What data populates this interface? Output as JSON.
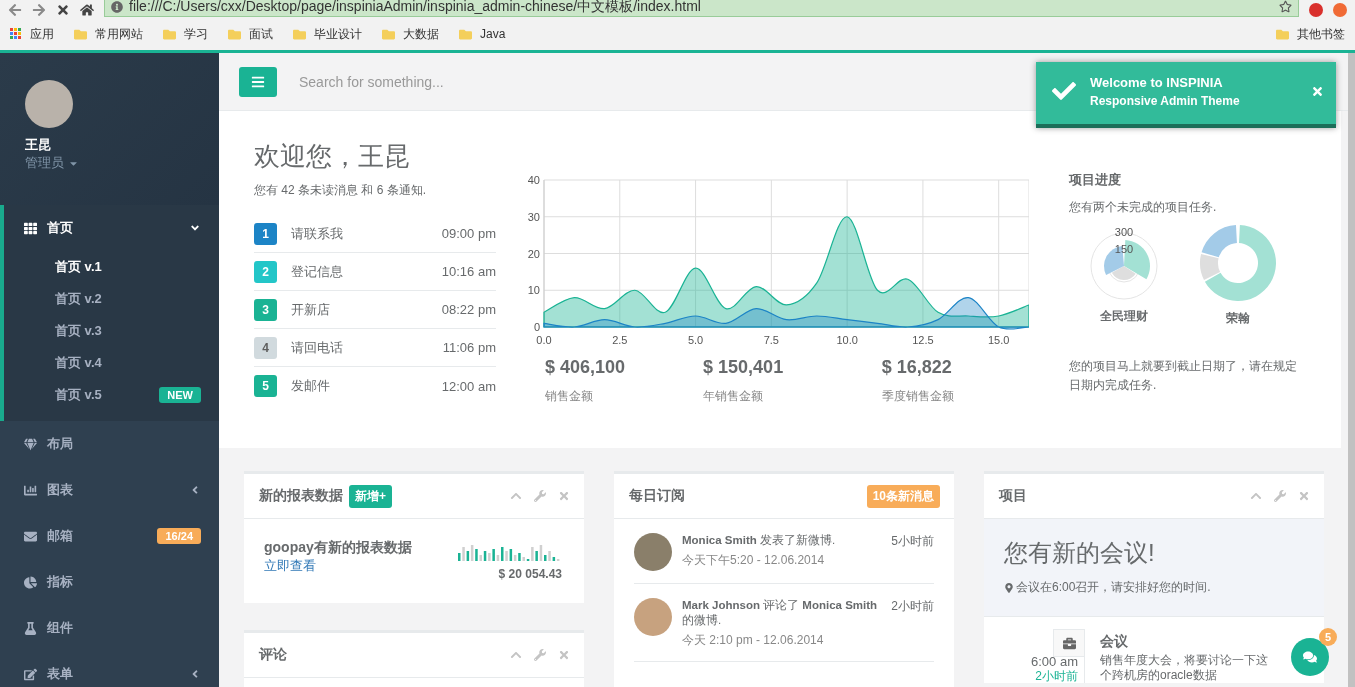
{
  "browser": {
    "url": "file:///C:/Users/cxx/Desktop/page/inspiniaAdmin/inspinia_admin-chinese/中文模板/index.html",
    "bookmarks": [
      {
        "label": "应用",
        "kind": "apps"
      },
      {
        "label": "常用网站",
        "kind": "folder"
      },
      {
        "label": "学习",
        "kind": "folder"
      },
      {
        "label": "面试",
        "kind": "folder"
      },
      {
        "label": "毕业设计",
        "kind": "folder"
      },
      {
        "label": "大数据",
        "kind": "folder"
      },
      {
        "label": "Java",
        "kind": "folder"
      }
    ],
    "other_bookmarks": "其他书签"
  },
  "toast": {
    "title": "Welcome to INSPINIA",
    "subtitle": "Responsive Admin Theme"
  },
  "sidebar": {
    "profile": {
      "name": "王昆",
      "role": "管理员"
    },
    "items": [
      {
        "label": "首页",
        "kind": "grid",
        "has_submenu": true,
        "expanded": true,
        "selected": true,
        "children": [
          {
            "label": "首页 v.1",
            "selected": true
          },
          {
            "label": "首页 v.2",
            "selected": false
          },
          {
            "label": "首页 v.3",
            "selected": false
          },
          {
            "label": "首页 v.4",
            "selected": false
          },
          {
            "label": "首页 v.5",
            "selected": false,
            "badge": {
              "text": "NEW",
              "color": "#1ab394"
            }
          }
        ]
      },
      {
        "label": "布局",
        "kind": "gem",
        "has_submenu": false,
        "selected": false
      },
      {
        "label": "图表",
        "kind": "chart",
        "has_submenu": true,
        "expanded": false,
        "selected": false
      },
      {
        "label": "邮箱",
        "kind": "mail",
        "has_submenu": false,
        "selected": false,
        "badge": {
          "text": "16/24",
          "color": "#f8ac59"
        }
      },
      {
        "label": "指标",
        "kind": "pie",
        "has_submenu": false,
        "selected": false
      },
      {
        "label": "组件",
        "kind": "flask",
        "has_submenu": false,
        "selected": false
      },
      {
        "label": "表单",
        "kind": "edit",
        "has_submenu": true,
        "expanded": false,
        "selected": false
      }
    ]
  },
  "search": {
    "placeholder": "Search for something..."
  },
  "welcome": {
    "title": "欢迎您，王昆",
    "subtitle": "您有 42 条未读消息 和 6 条通知."
  },
  "tasks": [
    {
      "number": "1",
      "label": "请联系我",
      "time": "09:00 pm",
      "color": "#1c84c6"
    },
    {
      "number": "2",
      "label": "登记信息",
      "time": "10:16 am",
      "color": "#23c6c8"
    },
    {
      "number": "3",
      "label": "开新店",
      "time": "08:22 pm",
      "color": "#1ab394"
    },
    {
      "number": "4",
      "label": "请回电话",
      "time": "11:06 pm",
      "color": "#d1dade"
    },
    {
      "number": "5",
      "label": "发邮件",
      "time": "12:00 am",
      "color": "#1ab394"
    }
  ],
  "chart_data": {
    "type": "area",
    "x": [
      0,
      1,
      2,
      3,
      4,
      5,
      6,
      7,
      8,
      9,
      10,
      11,
      12,
      13,
      14,
      15,
      16
    ],
    "series": [
      {
        "color": "#1ab394",
        "values": [
          4,
          8,
          5,
          10,
          4,
          16,
          5,
          11,
          6,
          12,
          30,
          10,
          13,
          4,
          3,
          3,
          6
        ]
      },
      {
        "color": "#1c84c6",
        "values": [
          1,
          0,
          2,
          0,
          1,
          3,
          1,
          5,
          2,
          3,
          2,
          1,
          0,
          2,
          8,
          0,
          0
        ]
      }
    ],
    "xlim": [
      0,
      16
    ],
    "ylim": [
      0,
      40
    ],
    "xticks": [
      {
        "value": 0,
        "label": "0.0"
      },
      {
        "value": 2.5,
        "label": "2.5"
      },
      {
        "value": 5,
        "label": "5.0"
      },
      {
        "value": 7.5,
        "label": "7.5"
      },
      {
        "value": 10,
        "label": "10.0"
      },
      {
        "value": 12.5,
        "label": "12.5"
      },
      {
        "value": 15,
        "label": "15.0"
      }
    ],
    "yticks": [
      0,
      10,
      20,
      30,
      40
    ],
    "grid": true
  },
  "stats": [
    {
      "value": "$ 406,100",
      "label": "销售金额"
    },
    {
      "value": "$ 150,401",
      "label": "年销售金额"
    },
    {
      "value": "$ 16,822",
      "label": "季度销售金额"
    }
  ],
  "progress": {
    "title": "项目进度",
    "subtitle": "您有两个未完成的项目任务.",
    "charts": [
      {
        "kind": "polar",
        "label": "全民理财",
        "scale": [
          "300",
          "150"
        ]
      },
      {
        "kind": "donut",
        "label": "荣翰"
      }
    ],
    "note": "您的项目马上就要到截止日期了，请在规定日期内完成任务."
  },
  "report_panel": {
    "title": "新的报表数据",
    "badge": "新增+",
    "heading": "goopay有新的报表数据",
    "link": "立即查看",
    "amount": "$ 20 054.43"
  },
  "comments_panel": {
    "title": "评论"
  },
  "feed_panel": {
    "title": "每日订阅",
    "badge": "10条新消息",
    "items": [
      {
        "text": "**Monica Smith** 发表了新微博.",
        "ago": "5小时前",
        "date": "今天下午5:20 - 12.06.2014"
      },
      {
        "text": "**Mark Johnson** 评论了 **Monica Smith** 的微博.",
        "ago": "2小时前",
        "date": "今天 2:10 pm - 12.06.2014"
      }
    ]
  },
  "project_panel": {
    "title": "项目",
    "meeting_title": "您有新的会议!",
    "meeting_note": "会议在6:00召开，请安排好您的时间.",
    "timeline": [
      {
        "time": "6:00 am",
        "ago": "2小时前",
        "title": "会议",
        "text": "销售年度大会，将要讨论一下这个跨机房的oracle数据"
      }
    ]
  },
  "chat": {
    "badge": "5"
  }
}
